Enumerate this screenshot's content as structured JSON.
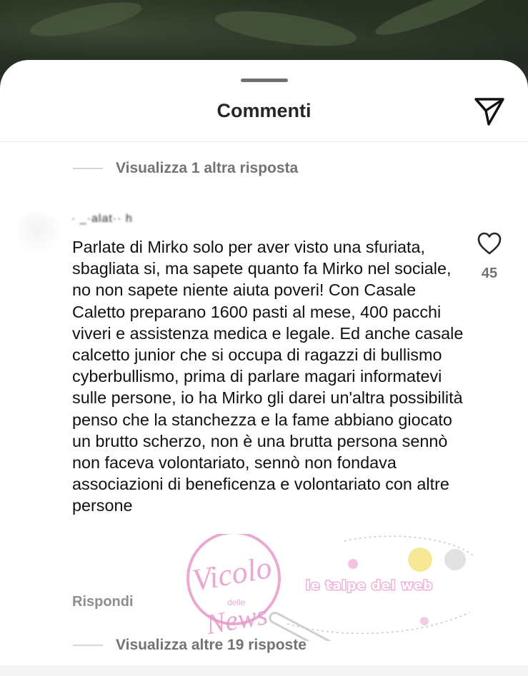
{
  "sheet": {
    "title": "Commenti"
  },
  "thread": {
    "view_more_top": "Visualizza 1 altra risposta",
    "view_more_bottom": "Visualizza altre 19 risposte"
  },
  "comment": {
    "username": "·  _·alat··   h",
    "text": "Parlate di Mirko solo per aver visto una sfuriata, sbagliata si, ma sapete quanto fa Mirko nel sociale, no non sapete niente aiuta poveri! Con Casale Caletto preparano 1600 pasti al mese, 400 pacchi viveri e assistenza medica e legale. Ed anche casale calcetto junior che si occupa di ragazzi di bullismo cyberbullismo, prima di parlare magari informatevi sulle persone, io ha Mirko gli darei un'altra possibilità penso che la stanchezza e la fame abbiano giocato un brutto scherzo, non è una brutta persona sennò non faceva volontariato, sennò non fondava associazioni di beneficenza e volontariato con altre persone",
    "likes": "45",
    "reply_label": "Rispondi"
  },
  "watermark": {
    "line1": "Vicolo",
    "line2": "delle",
    "line3": "News",
    "tagline": "le talpe del web"
  },
  "icons": {
    "send": "paper-plane-icon",
    "like": "heart-outline-icon"
  },
  "colors": {
    "title": "#262626",
    "secondary_text": "#737373",
    "watermark_pink": "#e59acb",
    "watermark_tagline": "#f0b3d8"
  }
}
